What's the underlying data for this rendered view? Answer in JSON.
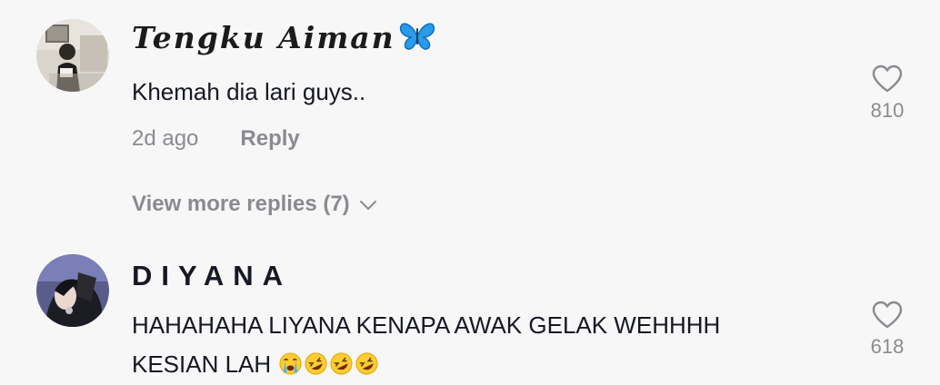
{
  "comments": [
    {
      "username": "Tengku Aiman",
      "text_lines": [
        "Khemah dia lari guys.."
      ],
      "time": "2d ago",
      "reply_label": "Reply",
      "view_more": "View more replies (7)",
      "likes": "810",
      "avatar_icon": "avatar-photo",
      "username_icon": "butterfly-icon"
    },
    {
      "username": "DIYANA",
      "text_lines": [
        "HAHAHAHA LIYANA KENAPA AWAK GELAK WEHHHH",
        "KESIAN LAH"
      ],
      "likes": "618",
      "avatar_icon": "avatar-photo",
      "emoji": [
        "loudly-crying-face",
        "rolling-on-floor-laughing",
        "rolling-on-floor-laughing",
        "rolling-on-floor-laughing"
      ]
    }
  ],
  "colors": {
    "background": "#f7f7f7",
    "text": "#161823",
    "muted": "#8a8b91",
    "butterfly": "#2a9bea"
  }
}
